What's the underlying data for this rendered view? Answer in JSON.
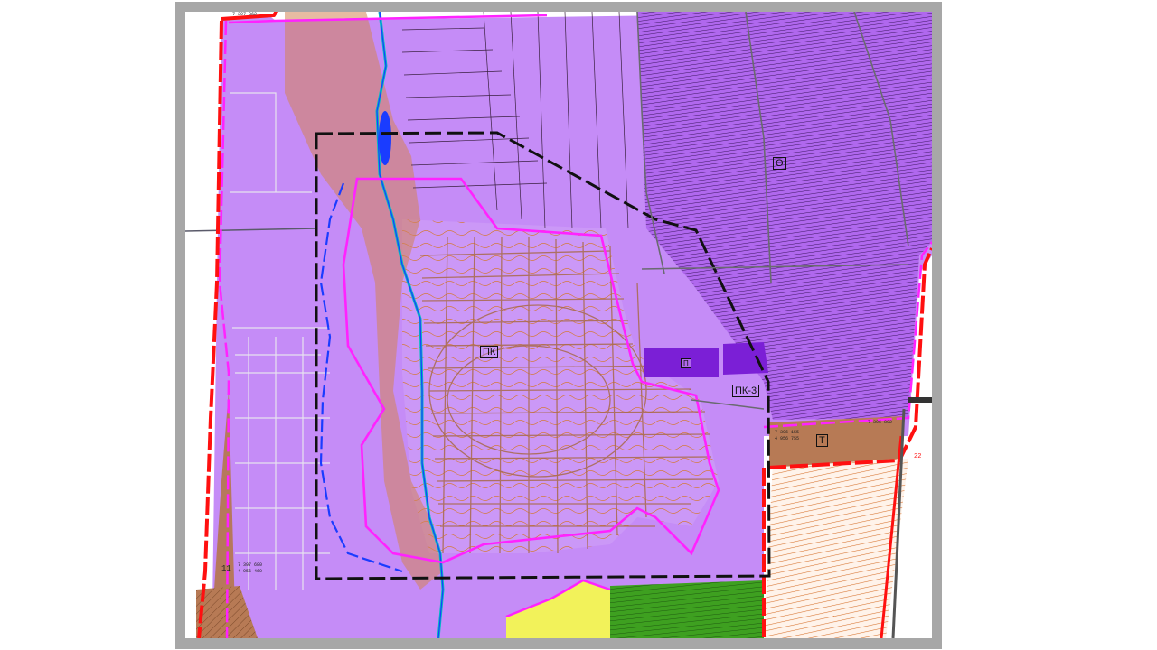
{
  "map": {
    "zones": {
      "pk": "ПК",
      "pk3": "ПК-3",
      "t": "Т",
      "o": "О",
      "marker": "П"
    },
    "coordinates": {
      "top_left": "7 397 862",
      "left_bottom_1": "7 397 680",
      "left_bottom_2": "4 956 460",
      "right_mid_1": "7 396 155",
      "right_mid_2": "4 956 755",
      "right_mid_3": "7 396 892"
    },
    "markers": {
      "left_marker": "11",
      "right_marker": "22"
    },
    "colors": {
      "lilac": "#c58cf7",
      "violet": "#a63fe0",
      "magenta": "#ff22ff",
      "red_boundary": "#ff1010",
      "brown": "#b77a55",
      "orange_contour": "#e0781e",
      "green": "#3a8a1a",
      "yellow": "#f2f25a",
      "blue": "#1a3cff",
      "frame": "#a7a7a7"
    }
  }
}
